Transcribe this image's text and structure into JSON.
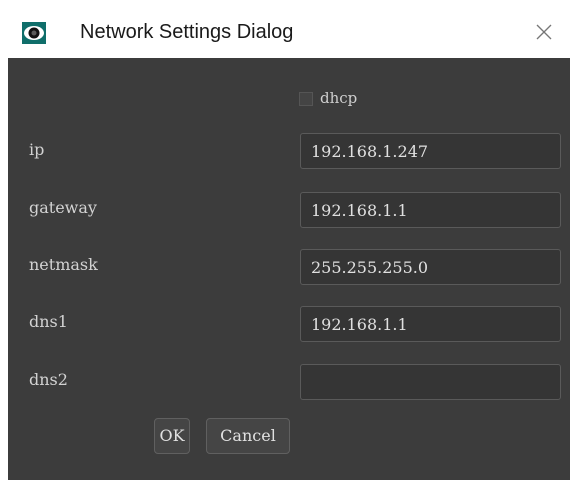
{
  "window": {
    "title": "Network Settings Dialog",
    "app_icon": "eye-icon",
    "close_icon": "close-icon"
  },
  "form": {
    "dhcp": {
      "label": "dhcp",
      "checked": false
    },
    "fields": {
      "ip": {
        "label": "ip",
        "value": "192.168.1.247"
      },
      "gateway": {
        "label": "gateway",
        "value": "192.168.1.1"
      },
      "netmask": {
        "label": "netmask",
        "value": "255.255.255.0"
      },
      "dns1": {
        "label": "dns1",
        "value": "192.168.1.1"
      },
      "dns2": {
        "label": "dns2",
        "value": ""
      }
    }
  },
  "buttons": {
    "ok_label": "OK",
    "cancel_label": "Cancel"
  },
  "colors": {
    "titlebar": "#ffffff",
    "panel": "#3c3c3c",
    "input_bg": "#353535",
    "text": "#d2d2d2",
    "icon_teal": "#0f6e6a"
  }
}
